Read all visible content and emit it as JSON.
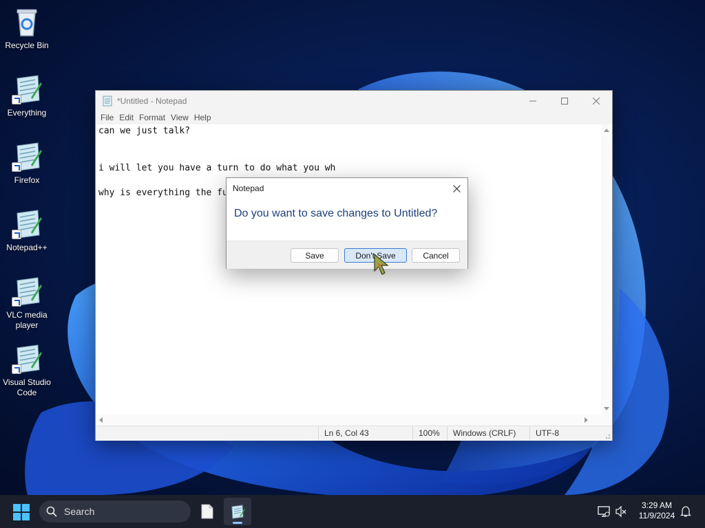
{
  "desktop": {
    "icons": [
      {
        "label": "Recycle Bin",
        "icon": "recycle-bin-icon"
      },
      {
        "label": "Everything",
        "icon": "notepad-shortcut-icon"
      },
      {
        "label": "Firefox",
        "icon": "notepad-shortcut-icon"
      },
      {
        "label": "Notepad++",
        "icon": "notepad-shortcut-icon"
      },
      {
        "label": "VLC media player",
        "icon": "notepad-shortcut-icon"
      },
      {
        "label": "Visual Studio Code",
        "icon": "notepad-shortcut-icon"
      }
    ]
  },
  "notepad": {
    "title": "*Untitled - Notepad",
    "menu": [
      "File",
      "Edit",
      "Format",
      "View",
      "Help"
    ],
    "lines": [
      "can we just talk?",
      "",
      "",
      "i will let you have a turn to do what you wh",
      "",
      "why is everything the fu"
    ],
    "status": {
      "position": "Ln 6, Col 43",
      "zoom": "100%",
      "line_ending": "Windows (CRLF)",
      "encoding": "UTF-8"
    }
  },
  "dialog": {
    "title": "Notepad",
    "message": "Do you want to save changes to Untitled?",
    "buttons": {
      "save": "Save",
      "dont_save": "Don't Save",
      "cancel": "Cancel"
    }
  },
  "taskbar": {
    "search_label": "Search",
    "clock": {
      "time": "3:29 AM",
      "date": "11/9/2024"
    }
  },
  "colors": {
    "accent": "#3b7bd1",
    "dialog_message": "#1e3f7a",
    "taskbar": "#1a1f2b"
  }
}
